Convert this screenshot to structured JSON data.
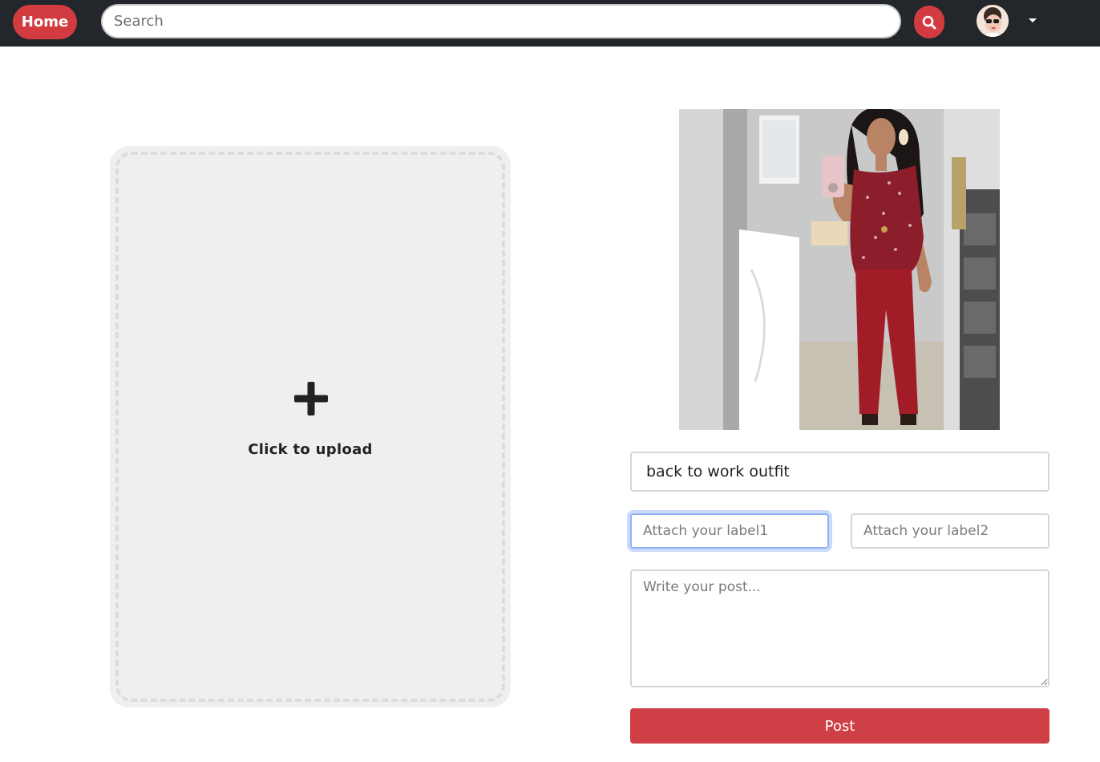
{
  "nav": {
    "home_label": "Home",
    "search_placeholder": "Search",
    "search_icon": "magnifier-icon",
    "avatar_icon": "user-avatar",
    "dropdown_icon": "caret-down-icon"
  },
  "upload": {
    "icon": "plus-icon",
    "label": "Click to upload"
  },
  "preview": {
    "alt": "Uploaded outfit photo"
  },
  "form": {
    "title_value": "back to work outfit",
    "label1_placeholder": "Attach your label1",
    "label2_placeholder": "Attach your label2",
    "post_placeholder": "Write your post...",
    "post_button": "Post"
  },
  "colors": {
    "nav_bg": "#23272b",
    "accent": "#d23c40",
    "focus_ring": "#c9dafb"
  }
}
